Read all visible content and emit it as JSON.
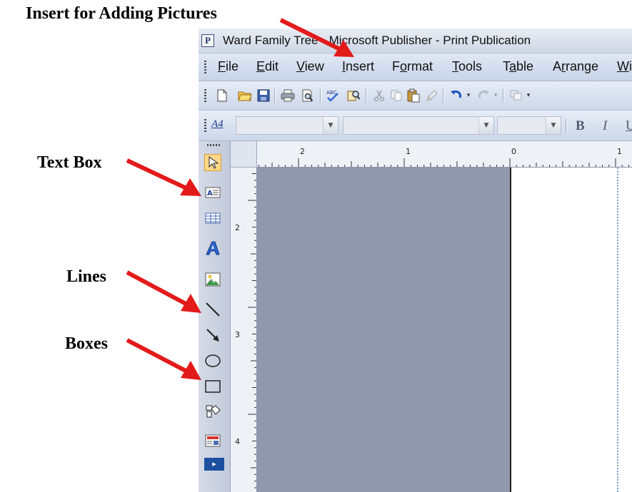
{
  "annotations": {
    "insert": "Insert for Adding Pictures",
    "text_box": "Text Box",
    "lines": "Lines",
    "boxes": "Boxes"
  },
  "window": {
    "icon_letter": "P",
    "title": "Ward Family Tree - Microsoft Publisher - Print Publication"
  },
  "menu": {
    "file": {
      "mnemonic": "F",
      "rest": "ile"
    },
    "edit": {
      "mnemonic": "E",
      "rest": "dit"
    },
    "view": {
      "mnemonic": "V",
      "rest": "iew"
    },
    "insert": {
      "mnemonic": "I",
      "rest": "nsert"
    },
    "format": {
      "pre": "F",
      "mnemonic": "o",
      "rest": "rmat"
    },
    "tools": {
      "mnemonic": "T",
      "rest": "ools"
    },
    "table": {
      "pre": "T",
      "mnemonic": "a",
      "rest": "ble"
    },
    "arrange": {
      "pre": "A",
      "mnemonic": "r",
      "rest": "range"
    },
    "window": {
      "mnemonic": "W",
      "rest": "i"
    }
  },
  "format_toolbar": {
    "style_icon": "A4",
    "bold": "B",
    "italic": "I",
    "underline": "U"
  },
  "ruler": {
    "h_labels": [
      "2",
      "1",
      "0",
      "1"
    ],
    "v_labels": [
      "2",
      "3",
      "4"
    ]
  },
  "icons": {
    "toolbar": [
      "new-icon",
      "open-icon",
      "save-icon",
      "print-icon",
      "print-preview-icon",
      "spelling-icon",
      "research-icon",
      "cut-icon",
      "copy-icon",
      "paste-icon",
      "format-painter-icon",
      "undo-icon",
      "redo-icon",
      "bring-forward-icon"
    ],
    "toolbox": [
      "select-pointer-icon",
      "text-box-icon",
      "table-icon",
      "wordart-icon",
      "picture-frame-icon",
      "line-icon",
      "arrow-icon",
      "oval-icon",
      "rectangle-icon",
      "autoshapes-icon",
      "design-gallery-icon",
      "more-tools-icon"
    ]
  },
  "colors": {
    "annotation_arrow": "#e31a1a",
    "workspace_gray": "#8f98ad",
    "toolbar_bg": "#d4dbe9"
  }
}
